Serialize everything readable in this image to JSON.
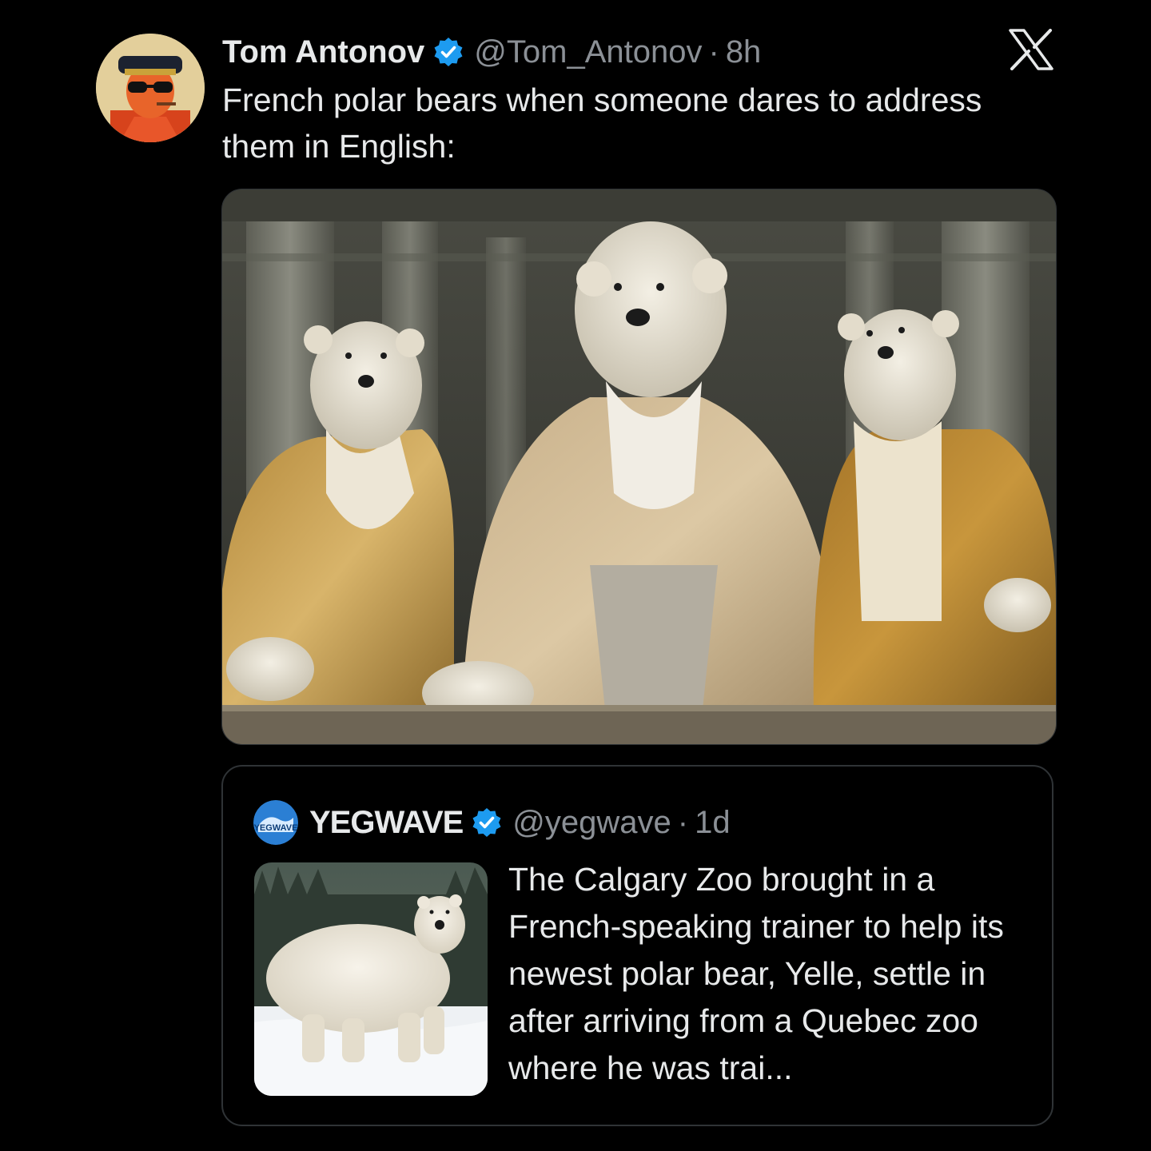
{
  "tweet": {
    "author_name": "Tom Antonov",
    "handle": "@Tom_Antonov",
    "separator": "·",
    "time": "8h",
    "text": "French polar bears when someone dares to address them in English:",
    "verified_icon": "verified-badge-icon",
    "platform_icon": "x-logo-icon"
  },
  "quoted_tweet": {
    "author_name": "YEGWAVE",
    "handle": "@yegwave",
    "separator": "·",
    "time": "1d",
    "text": "The Calgary Zoo brought in a French-speaking trainer to help its newest polar bear, Yelle, settle in after arriving from a Quebec zoo where he was trai...",
    "avatar_label": "YEGWAVE"
  },
  "colors": {
    "background": "#000000",
    "text_primary": "#e7e9ea",
    "text_secondary": "#8b9096",
    "verified_blue": "#1d9bf0",
    "border": "#2f3336"
  }
}
